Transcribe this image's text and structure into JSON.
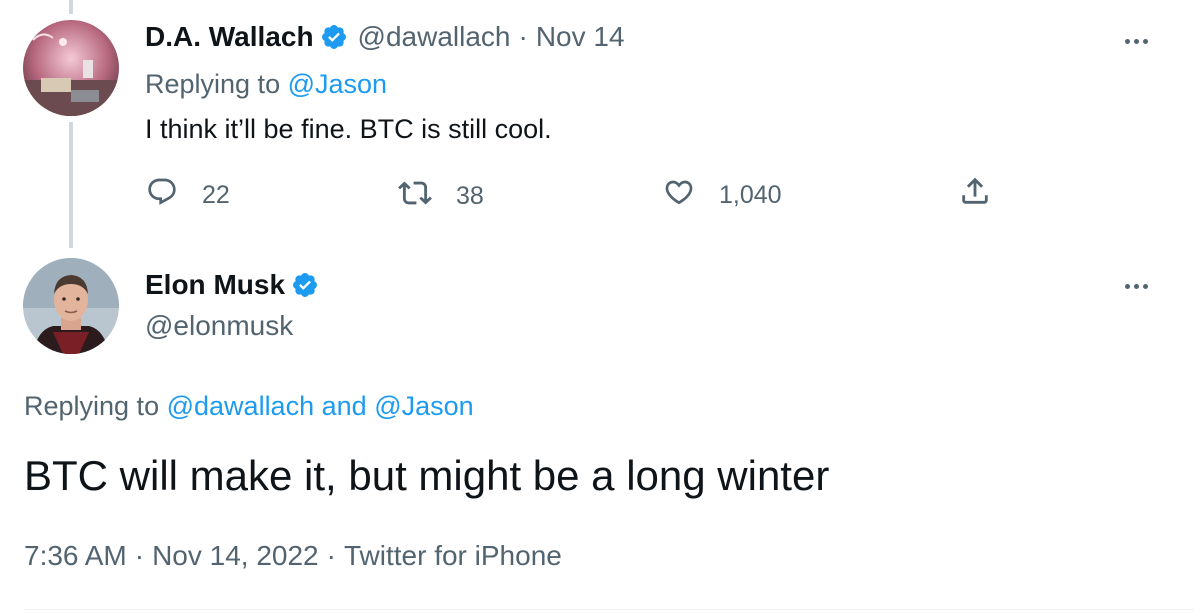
{
  "reply_tweet": {
    "display_name": "D.A. Wallach",
    "handle": "@dawallach",
    "date": "Nov 14",
    "replying_prefix": "Replying to",
    "replying_to": "@Jason",
    "text": "I think it’ll be fine. BTC is still cool.",
    "actions": {
      "reply_count": "22",
      "retweet_count": "38",
      "like_count": "1,040"
    },
    "avatar_icon": "dawallach-avatar"
  },
  "main_tweet": {
    "display_name": "Elon Musk",
    "handle": "@elonmusk",
    "replying_prefix": "Replying to",
    "replying_to_1": "@dawallach",
    "and_word": "and",
    "replying_to_2": "@Jason",
    "text": "BTC will make it, but might be a long winter",
    "time": "7:36 AM",
    "date": "Nov 14, 2022",
    "source": "Twitter for iPhone",
    "separator": "·",
    "avatar_icon": "elonmusk-avatar"
  },
  "colors": {
    "accent": "#1d9bf0",
    "secondary_text": "#536471",
    "primary_text": "#0f1419",
    "thread_line": "#cfd9de"
  },
  "icons": [
    "verified-badge-icon",
    "reply-icon",
    "retweet-icon",
    "like-icon",
    "share-icon",
    "more-icon"
  ]
}
